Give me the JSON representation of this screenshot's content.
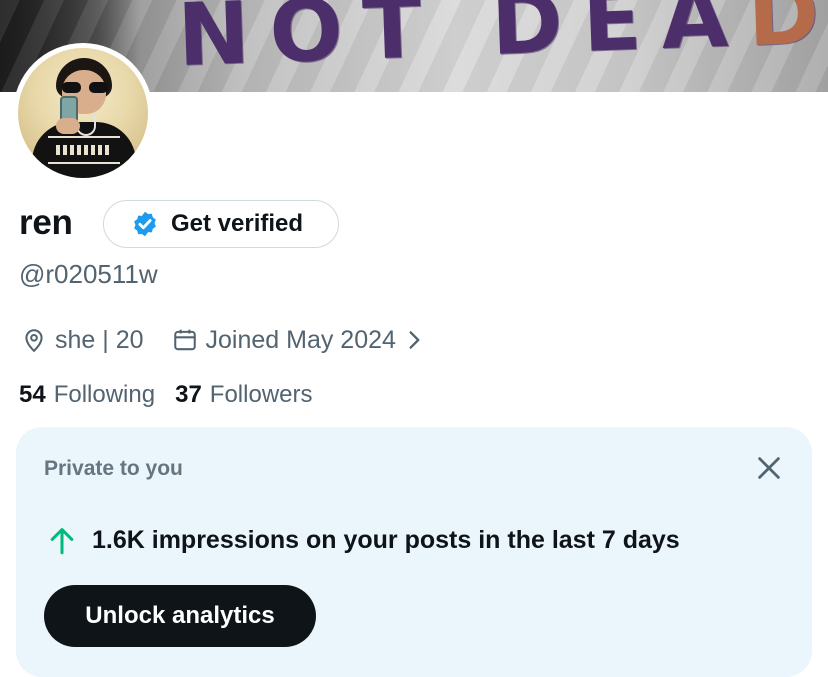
{
  "banner": {
    "text": "NOT DEA",
    "tail": "D"
  },
  "profile": {
    "name": "ren",
    "verify_label": "Get verified",
    "handle": "@r020511w",
    "location": "she | 20",
    "joined": "Joined May 2024",
    "following_count": "54",
    "following_label": "Following",
    "followers_count": "37",
    "followers_label": "Followers"
  },
  "analytics_card": {
    "title": "Private to you",
    "stat": "1.6K impressions on your posts in the last 7 days",
    "button_label": "Unlock analytics"
  },
  "colors": {
    "accent_blue": "#1d9bf0",
    "up_arrow_green": "#00ba7c",
    "card_bg": "#eaf6fb",
    "secondary_text": "#536471",
    "primary_text": "#0f1419"
  },
  "icons": {
    "verified": "verified-badge-icon",
    "location": "location-pin-icon",
    "calendar": "calendar-icon",
    "chevron": "chevron-right-icon",
    "close": "close-icon",
    "up_arrow": "arrow-up-icon"
  }
}
